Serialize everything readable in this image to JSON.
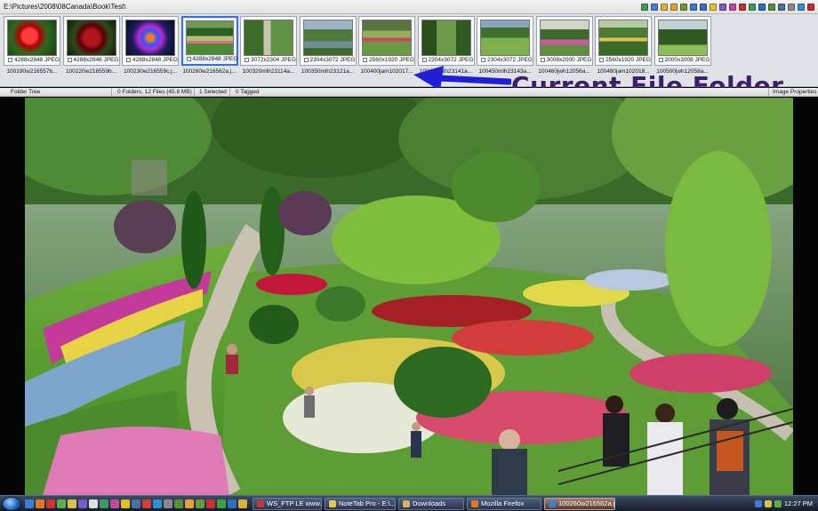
{
  "window": {
    "path": "E:\\Pictures\\2008\\08Canada\\Book\\Test\\"
  },
  "toolbar": {
    "icons": [
      "view-icon",
      "edit-icon",
      "folder-icon",
      "copy-icon",
      "move-icon",
      "rename-icon",
      "search-icon",
      "star-icon",
      "tag-icon",
      "color-icon",
      "delete-icon",
      "rotate-icon",
      "slideshow-icon",
      "zoom-icon",
      "grid-icon",
      "properties-icon",
      "info-icon",
      "close-icon"
    ]
  },
  "thumbnails": [
    {
      "dims": "4288x2848 JPEG",
      "name": "100190w216557b...",
      "fill": "g-rose-red"
    },
    {
      "dims": "4288x2848 JPEG",
      "name": "100220w216559b...",
      "fill": "g-rose-dark"
    },
    {
      "dims": "4288x2848 JPEG",
      "name": "100230w216559c.j...",
      "fill": "g-rose-blue"
    },
    {
      "dims": "4288x2848 JPEG",
      "name": "100260w216562a.j...",
      "fill": "g-garden",
      "selected": true
    },
    {
      "dims": "3072x2304 JPEG",
      "name": "100320mlh23114a...",
      "fill": "g-path"
    },
    {
      "dims": "2304x3072 JPEG",
      "name": "100350mlh23121a...",
      "fill": "g-pond"
    },
    {
      "dims": "2560x1920 JPEG",
      "name": "100400jam102017...",
      "fill": "g-bed"
    },
    {
      "dims": "2304x3072 JPEG",
      "name": "100410mlh23141a...",
      "fill": "g-tree"
    },
    {
      "dims": "2304x3072 JPEG",
      "name": "100450mlh23143a...",
      "fill": "g-lawn"
    },
    {
      "dims": "3008x2000 JPEG",
      "name": "100460jwh12056a...",
      "fill": "g-flower"
    },
    {
      "dims": "2560x1920 JPEG",
      "name": "100480jam102018...",
      "fill": "g-mixed"
    },
    {
      "dims": "2000x3008 JPEG",
      "name": "100500jwh12058a...",
      "fill": "g-hedge"
    }
  ],
  "callout": {
    "text": "Current File Folder"
  },
  "panebar": {
    "folder_tree": "Folder Tree",
    "folders_files": "0 Folders, 12 Files (45.8 MB)",
    "selected": "1 Selected",
    "tagged": "0 Tagged",
    "image_properties": "Image Properties"
  },
  "taskbar": {
    "tasks": [
      {
        "label": "WS_FTP LE www.i...",
        "color": "#c33"
      },
      {
        "label": "NoteTab Pro - E:\\...",
        "color": "#e8c84a"
      },
      {
        "label": "Downloads",
        "color": "#d9b45a"
      },
      {
        "label": "Mozilla Firefox",
        "color": "#e07a22"
      },
      {
        "label": "100260w216562a.j...",
        "color": "#3b7dd8",
        "active": true
      }
    ],
    "clock": "12:27 PM"
  }
}
